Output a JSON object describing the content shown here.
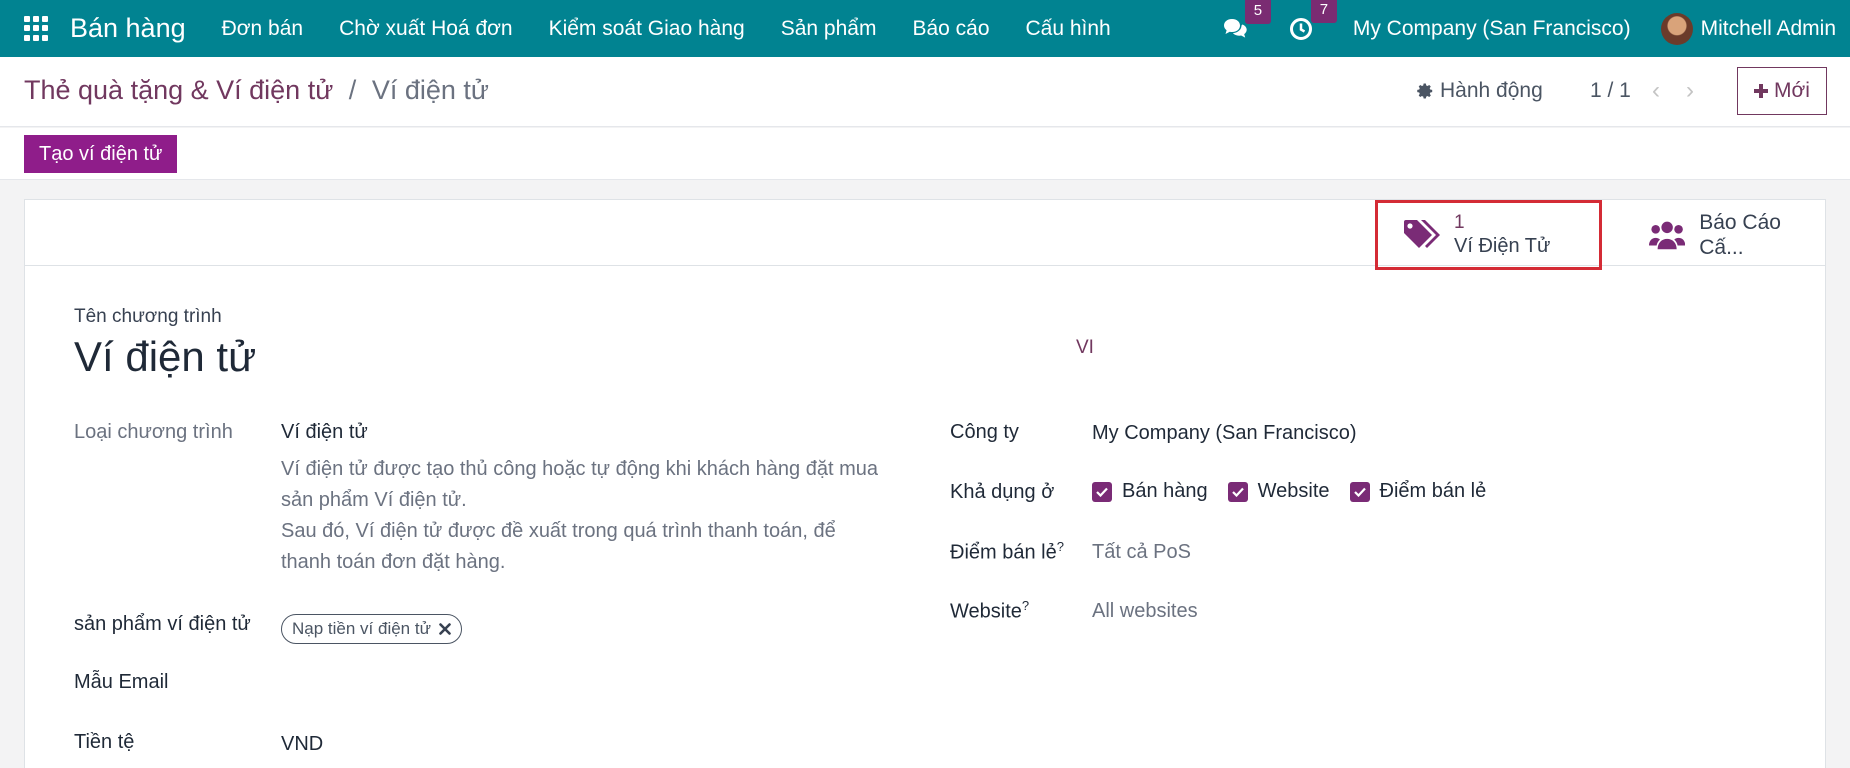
{
  "navbar": {
    "brand": "Bán hàng",
    "menu": [
      "Đơn bán",
      "Chờ xuất Hoá đơn",
      "Kiểm soát Giao hàng",
      "Sản phẩm",
      "Báo cáo",
      "Cấu hình"
    ],
    "messages_count": "5",
    "activities_count": "7",
    "company": "My Company (San Francisco)",
    "user": "Mitchell Admin"
  },
  "control": {
    "breadcrumb_parent": "Thẻ quà tặng & Ví điện tử",
    "breadcrumb_separator": "/",
    "breadcrumb_current": "Ví điện tử",
    "action_label": "Hành động",
    "pager": "1 / 1",
    "new_label": "Mới"
  },
  "statusbar": {
    "create_label": "Tạo ví điện tử"
  },
  "smart_buttons": [
    {
      "count": "1",
      "label": "Ví Điện Tử",
      "icon": "tags-icon"
    },
    {
      "label": "Báo Cáo Cấ...",
      "icon": "users-icon"
    }
  ],
  "form": {
    "name_label": "Tên chương trình",
    "name_value": "Ví điện tử",
    "lang_tag": "VI",
    "program_type_label": "Loại chương trình",
    "program_type_value": "Ví điện tử",
    "description_line1": "Ví điện tử được tạo thủ công hoặc tự động khi khách hàng đặt mua sản phẩm Ví điện tử.",
    "description_line2": "Sau đó, Ví điện tử được đề xuất trong quá trình thanh toán, để thanh toán đơn đặt hàng.",
    "product_label": "sản phẩm ví điện tử",
    "product_tag": "Nạp tiền ví điện tử",
    "email_template_label": "Mẫu Email",
    "currency_label": "Tiền tệ",
    "currency_value": "VND",
    "company_label": "Công ty",
    "company_value": "My Company (San Francisco)",
    "available_label": "Khả dụng ở",
    "available_options": [
      "Bán hàng",
      "Website",
      "Điểm bán lẻ"
    ],
    "pos_label": "Điểm bán lẻ",
    "pos_value": "Tất cả PoS",
    "website_label": "Website",
    "website_value": "All websites",
    "help_mark": "?"
  },
  "colors": {
    "navbar": "#018391",
    "primary": "#71385f",
    "button": "#8f1d8a",
    "highlight_border": "#d42b35"
  }
}
